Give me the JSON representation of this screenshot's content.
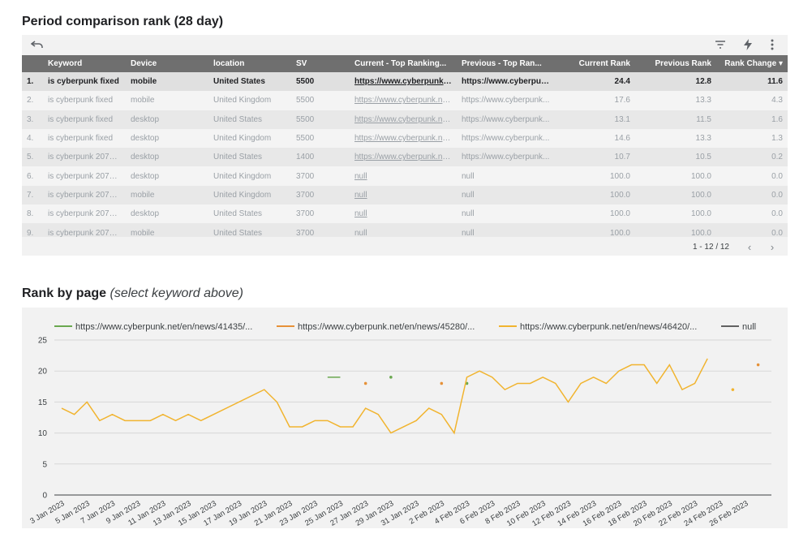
{
  "table_section": {
    "title": "Period comparison rank (28 day)",
    "toolbar": {
      "undo_icon": "undo-icon",
      "filter_icon": "filter-icon",
      "bolt_icon": "bolt-icon",
      "more_icon": "more-vert-icon"
    },
    "columns": [
      "Keyword",
      "Device",
      "location",
      "SV",
      "Current - Top Ranking...",
      "Previous - Top Ran...",
      "Current Rank",
      "Previous Rank",
      "Rank Change"
    ],
    "sort_indicator": "▾",
    "rows": [
      [
        "1.",
        "is cyberpunk fixed",
        "mobile",
        "United States",
        "5500",
        "https://www.cyberpunk.n...",
        "https://www.cyberpunk...",
        "24.4",
        "12.8",
        "11.6"
      ],
      [
        "2.",
        "is cyberpunk fixed",
        "mobile",
        "United Kingdom",
        "5500",
        "https://www.cyberpunk.ne...",
        "https://www.cyberpunk...",
        "17.6",
        "13.3",
        "4.3"
      ],
      [
        "3.",
        "is cyberpunk fixed",
        "desktop",
        "United States",
        "5500",
        "https://www.cyberpunk.ne...",
        "https://www.cyberpunk...",
        "13.1",
        "11.5",
        "1.6"
      ],
      [
        "4.",
        "is cyberpunk fixed",
        "desktop",
        "United Kingdom",
        "5500",
        "https://www.cyberpunk.ne...",
        "https://www.cyberpunk...",
        "14.6",
        "13.3",
        "1.3"
      ],
      [
        "5.",
        "is cyberpunk 2077 ...",
        "desktop",
        "United States",
        "1400",
        "https://www.cyberpunk.ne...",
        "https://www.cyberpunk...",
        "10.7",
        "10.5",
        "0.2"
      ],
      [
        "6.",
        "is cyberpunk 2077 ...",
        "desktop",
        "United Kingdom",
        "3700",
        "null",
        "null",
        "100.0",
        "100.0",
        "0.0"
      ],
      [
        "7.",
        "is cyberpunk 2077 ...",
        "mobile",
        "United Kingdom",
        "3700",
        "null",
        "null",
        "100.0",
        "100.0",
        "0.0"
      ],
      [
        "8.",
        "is cyberpunk 2077 ...",
        "desktop",
        "United States",
        "3700",
        "null",
        "null",
        "100.0",
        "100.0",
        "0.0"
      ],
      [
        "9.",
        "is cyberpunk 2077 ...",
        "mobile",
        "United States",
        "3700",
        "null",
        "null",
        "100.0",
        "100.0",
        "0.0"
      ]
    ],
    "pager": {
      "range": "1 - 12 / 12",
      "prev_icon": "‹",
      "next_icon": "›"
    }
  },
  "chart_section": {
    "title_bold": "Rank by page",
    "title_italic": "(select keyword above)"
  },
  "chart_data": {
    "type": "line",
    "title": "Rank by page",
    "ylim": [
      0,
      25
    ],
    "yticks": [
      0,
      5,
      10,
      15,
      20,
      25
    ],
    "grid": true,
    "legend_position": "top",
    "x_tick_labels": [
      "3 Jan 2023",
      "5 Jan 2023",
      "7 Jan 2023",
      "9 Jan 2023",
      "11 Jan 2023",
      "13 Jan 2023",
      "15 Jan 2023",
      "17 Jan 2023",
      "19 Jan 2023",
      "21 Jan 2023",
      "23 Jan 2023",
      "25 Jan 2023",
      "27 Jan 2023",
      "29 Jan 2023",
      "31 Jan 2023",
      "2 Feb 2023",
      "4 Feb 2023",
      "6 Feb 2023",
      "8 Feb 2023",
      "10 Feb 2023",
      "12 Feb 2023",
      "14 Feb 2023",
      "16 Feb 2023",
      "18 Feb 2023",
      "20 Feb 2023",
      "22 Feb 2023",
      "24 Feb 2023",
      "26 Feb 2023"
    ],
    "series": [
      {
        "name": "https://www.cyberpunk.net/en/news/41435/...",
        "color": "#6aa84f",
        "points": [
          [
            "2023-01-24",
            19
          ],
          [
            "2023-01-25",
            19
          ],
          [
            "2023-01-29",
            19
          ],
          [
            "2023-02-04",
            18
          ]
        ]
      },
      {
        "name": "https://www.cyberpunk.net/en/news/45280/...",
        "color": "#e69138",
        "points": [
          [
            "2023-01-27",
            18
          ],
          [
            "2023-02-02",
            18
          ],
          [
            "2023-02-27",
            21
          ]
        ]
      },
      {
        "name": "https://www.cyberpunk.net/en/news/46420/...",
        "color": "#f1b42f",
        "segments": [
          [
            [
              "2023-01-03",
              14
            ],
            [
              "2023-01-04",
              13
            ],
            [
              "2023-01-05",
              15
            ],
            [
              "2023-01-06",
              12
            ],
            [
              "2023-01-07",
              13
            ],
            [
              "2023-01-08",
              12
            ],
            [
              "2023-01-09",
              12
            ],
            [
              "2023-01-10",
              12
            ],
            [
              "2023-01-11",
              13
            ],
            [
              "2023-01-12",
              12
            ],
            [
              "2023-01-13",
              13
            ],
            [
              "2023-01-14",
              12
            ],
            [
              "2023-01-19",
              17
            ],
            [
              "2023-01-20",
              15
            ],
            [
              "2023-01-21",
              11
            ],
            [
              "2023-01-22",
              11
            ],
            [
              "2023-01-23",
              12
            ],
            [
              "2023-01-24",
              12
            ],
            [
              "2023-01-25",
              11
            ],
            [
              "2023-01-26",
              11
            ],
            [
              "2023-01-27",
              14
            ],
            [
              "2023-01-28",
              13
            ],
            [
              "2023-01-29",
              10
            ],
            [
              "2023-01-30",
              11
            ],
            [
              "2023-01-31",
              12
            ],
            [
              "2023-02-01",
              14
            ],
            [
              "2023-02-02",
              13
            ],
            [
              "2023-02-03",
              10
            ],
            [
              "2023-02-04",
              19
            ],
            [
              "2023-02-05",
              20
            ],
            [
              "2023-02-06",
              19
            ],
            [
              "2023-02-07",
              17
            ],
            [
              "2023-02-08",
              18
            ],
            [
              "2023-02-09",
              18
            ],
            [
              "2023-02-10",
              19
            ],
            [
              "2023-02-11",
              18
            ],
            [
              "2023-02-12",
              15
            ],
            [
              "2023-02-13",
              18
            ],
            [
              "2023-02-14",
              19
            ],
            [
              "2023-02-15",
              18
            ],
            [
              "2023-02-16",
              20
            ],
            [
              "2023-02-17",
              21
            ],
            [
              "2023-02-18",
              21
            ],
            [
              "2023-02-19",
              18
            ],
            [
              "2023-02-20",
              21
            ],
            [
              "2023-02-21",
              17
            ],
            [
              "2023-02-22",
              18
            ],
            [
              "2023-02-23",
              22
            ]
          ],
          [
            [
              "2023-02-25",
              17
            ]
          ]
        ]
      },
      {
        "name": "null",
        "color": "#616161",
        "points": []
      }
    ]
  }
}
